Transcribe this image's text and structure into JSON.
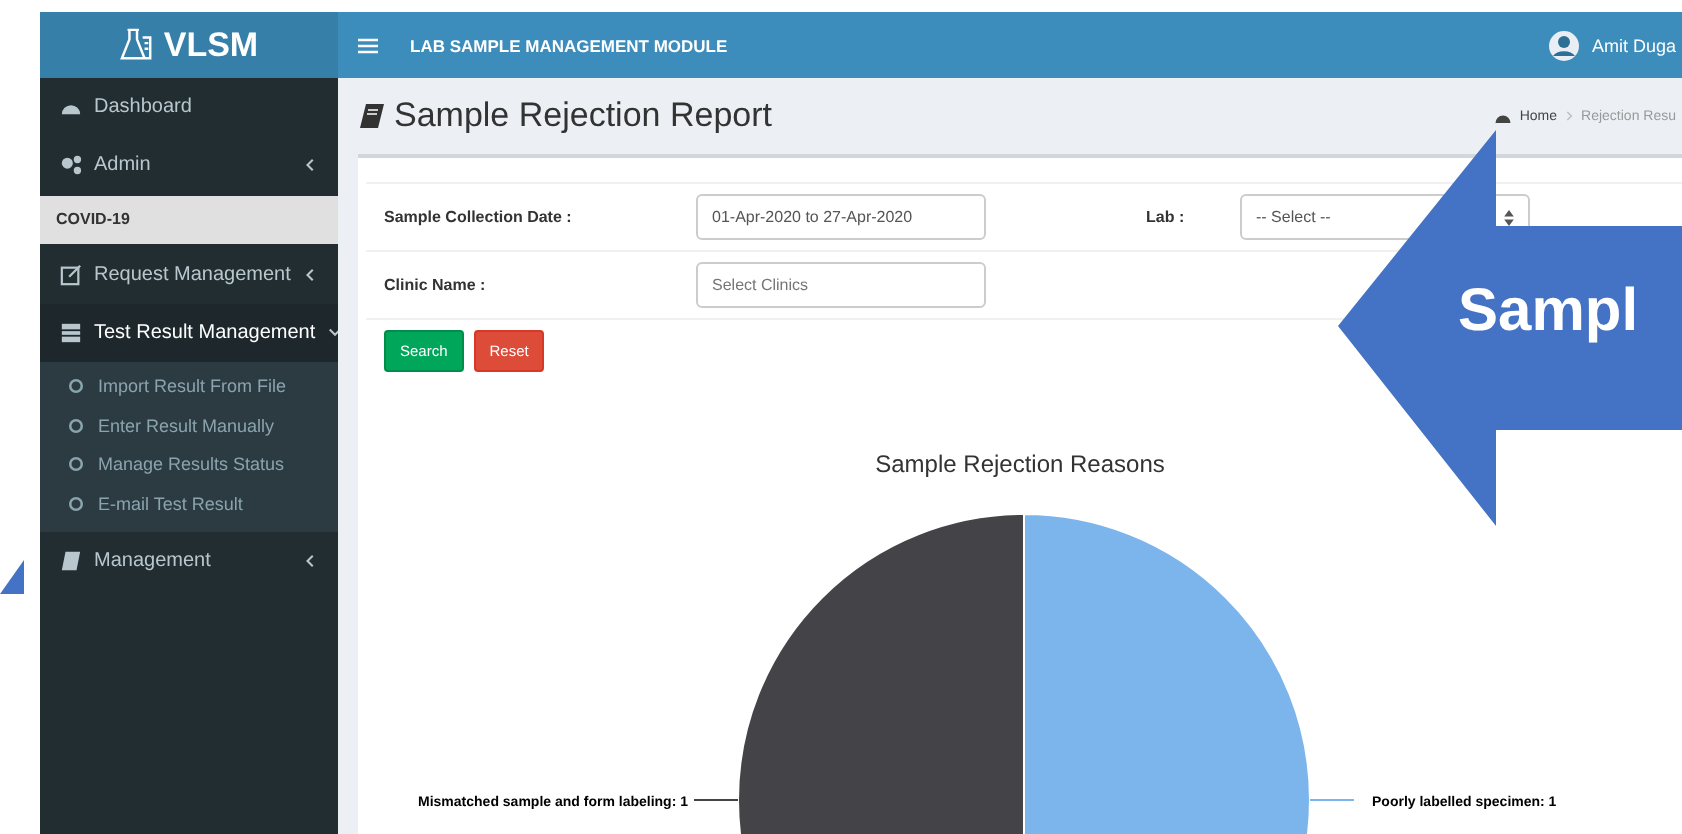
{
  "app": {
    "logo": "VLSM",
    "module_title": "LAB SAMPLE MANAGEMENT MODULE",
    "user": "Amit Duga"
  },
  "sidebar": {
    "items": [
      {
        "kind": "link",
        "label": "Dashboard"
      },
      {
        "kind": "item",
        "label": "Admin",
        "expanded": false
      },
      {
        "kind": "header",
        "label": "COVID-19"
      },
      {
        "kind": "item",
        "label": "Request Management",
        "expanded": false
      },
      {
        "kind": "item",
        "label": "Test Result Management",
        "expanded": true,
        "children": [
          {
            "label": "Import Result From File"
          },
          {
            "label": "Enter Result Manually"
          },
          {
            "label": "Manage Results Status"
          },
          {
            "label": "E-mail Test Result"
          }
        ]
      },
      {
        "kind": "item",
        "label": "Management",
        "expanded": false
      }
    ]
  },
  "page": {
    "title": "Sample Rejection Report",
    "breadcrumb": [
      "Home",
      "Rejection Resu"
    ]
  },
  "filters": [
    {
      "kind": "input",
      "label": "Sample Collection Date :",
      "value": "01-Apr-2020 to 27-Apr-2020"
    },
    {
      "kind": "select",
      "label": "Lab :",
      "value": "-- Select --"
    },
    {
      "kind": "input",
      "label": "Clinic Name :",
      "placeholder": "Select Clinics"
    }
  ],
  "buttons": [
    {
      "kind": "success",
      "label": "Search"
    },
    {
      "kind": "danger",
      "label": "Reset"
    }
  ],
  "chart": {
    "chart_data": {
      "type": "pie",
      "title": "Sample Rejection Reasons",
      "values": [
        1,
        1
      ],
      "value_labels": [
        "Poorly labelled specimen: 1",
        "Mismatched sample and form labeling: 1"
      ]
    }
  },
  "callout": {
    "text": "Sampl"
  }
}
